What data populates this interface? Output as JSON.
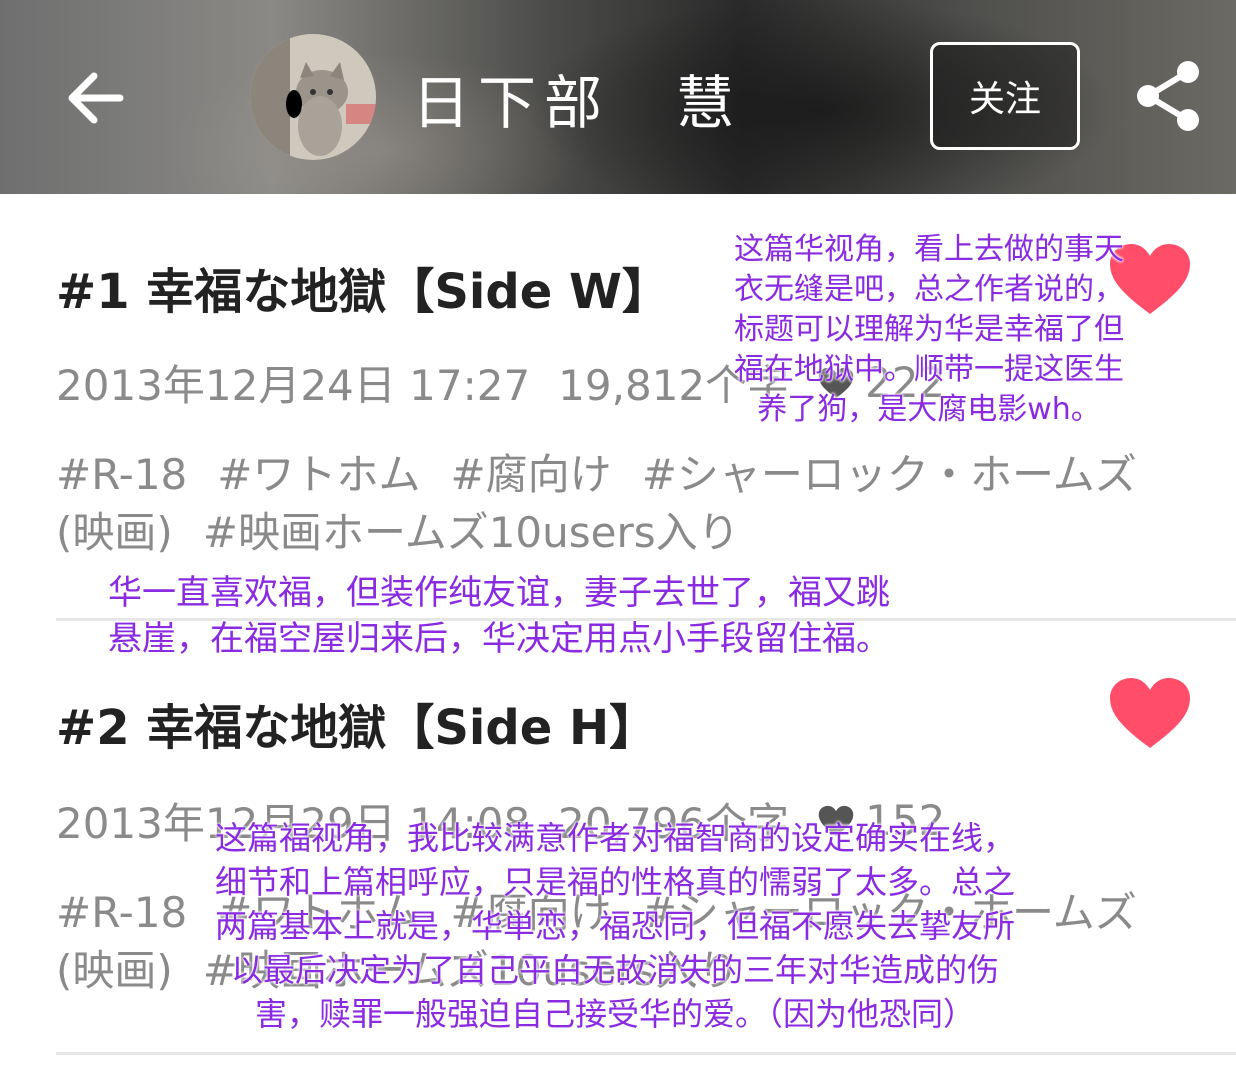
{
  "header": {
    "back_icon": "arrow-left-icon",
    "avatar_alt": "cat photo avatar",
    "user_name": "日下部　慧",
    "follow_label": "关注",
    "share_icon": "share-icon"
  },
  "colors": {
    "heart": "#ff4d6a",
    "title": "#222222",
    "meta": "#8a8a8a",
    "annotation": "#8a2be2",
    "divider": "#e6e6e6"
  },
  "works": [
    {
      "title": "#1 幸福な地獄【Side W】",
      "date": "2013年12月24日 17:27",
      "char_count": "19,812个字",
      "likes": "222",
      "tags": [
        "#R-18",
        "#ワトホム",
        "#腐向け",
        "#シャーロック・ホームズ(映画)",
        "#映画ホームズ10users入り"
      ]
    },
    {
      "title": "#2 幸福な地獄【Side H】",
      "date": "2013年12月29日 14:08",
      "char_count": "20,796个字",
      "likes": "152",
      "tags": [
        "#R-18",
        "#ワトホム",
        "#腐向け",
        "#シャーロック・ホームズ(映画)",
        "#映画ホームズ10users入り"
      ]
    }
  ],
  "annotations": {
    "note_1": "这篇华视角，看上去做的事天\n衣无缝是吧，总之作者说的，\n标题可以理解为华是幸福了但\n福在地狱中。顺带一提这医生\n养了狗，是大腐电影wh。",
    "note_2": "华一直喜欢福，但装作纯友谊，妻子去世了，福又跳\n悬崖，在福空屋归来后，华决定用点小手段留住福。",
    "note_3": "这篇福视角，我比较满意作者对福智商的设定确实在线，\n细节和上篇相呼应，只是福的性格真的懦弱了太多。总之\n两篇基本上就是，华単恋，福恐同，但福不愿失去挚友所\n以最后决定为了自己平白无故消失的三年对华造成的伤\n害，赎罪一般强迫自己接受华的爱。（因为他恐同）"
  }
}
